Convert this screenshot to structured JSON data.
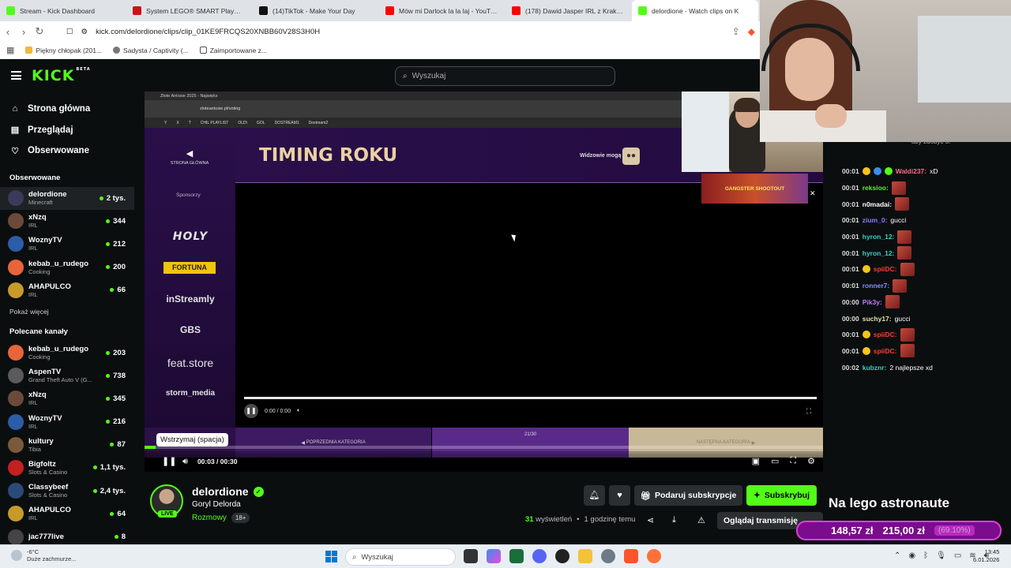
{
  "browser": {
    "tabs": [
      {
        "title": "Stream - Kick Dashboard",
        "icon": "kick"
      },
      {
        "title": "System LEGO® SMART Play™ | Witaj",
        "icon": "lego"
      },
      {
        "title": "(14)TikTok - Make Your Day",
        "icon": "tt"
      },
      {
        "title": "Mów mi Darlock la la laj - YouTube",
        "icon": "yt"
      },
      {
        "title": "(178) Dawid Jasper IRL z Krakowa - S",
        "icon": "yt"
      },
      {
        "title": "delordione - Watch clips on K",
        "icon": "kick",
        "active": true
      }
    ],
    "url": "kick.com/delordione/clips/clip_01KE9FRCQS20XNBB60V28S3H0H",
    "bookmarks": [
      "Piękny chłopak (201...",
      "Sadysta / Captivity (...",
      "Zaimportowane z..."
    ]
  },
  "header": {
    "logo": "KICK",
    "logo_badge": "BETA",
    "search_placeholder": "Wyszukaj"
  },
  "sidebar": {
    "nav": [
      "Strona główna",
      "Przeglądaj",
      "Obserwowane"
    ],
    "followed_title": "Obserwowane",
    "followed": [
      {
        "name": "delordione",
        "category": "Minecraft",
        "viewers": "2 tys.",
        "color": "#3a3a5a"
      },
      {
        "name": "xNzq",
        "category": "IRL",
        "viewers": "344",
        "color": "#6b4a3a"
      },
      {
        "name": "WoznyTV",
        "category": "IRL",
        "viewers": "212",
        "color": "#2b5da8"
      },
      {
        "name": "kebab_u_rudego",
        "category": "Cooking",
        "viewers": "200",
        "color": "#e8643a"
      },
      {
        "name": "AHAPULCO",
        "category": "IRL",
        "viewers": "66",
        "color": "#c89a2a"
      }
    ],
    "show_more": "Pokaż więcej",
    "recommended_title": "Polecane kanały",
    "recommended": [
      {
        "name": "kebab_u_rudego",
        "category": "Cooking",
        "viewers": "203",
        "color": "#e8643a"
      },
      {
        "name": "AspenTV",
        "category": "Grand Theft Auto V (G...",
        "viewers": "738",
        "color": "#5a5a5a"
      },
      {
        "name": "xNzq",
        "category": "IRL",
        "viewers": "345",
        "color": "#6b4a3a"
      },
      {
        "name": "WoznyTV",
        "category": "IRL",
        "viewers": "216",
        "color": "#2b5da8"
      },
      {
        "name": "kultury",
        "category": "Tibia",
        "viewers": "87",
        "color": "#7a5a3a"
      },
      {
        "name": "Bigfoltz",
        "category": "Slots & Casino",
        "viewers": "1,1 tys.",
        "color": "#c42020"
      },
      {
        "name": "Classybeef",
        "category": "Slots & Casino",
        "viewers": "2,4 tys.",
        "color": "#2a4a7a"
      },
      {
        "name": "AHAPULCO",
        "category": "IRL",
        "viewers": "64",
        "color": "#c89a2a"
      },
      {
        "name": "jac777live",
        "category": "",
        "viewers": "8",
        "color": "#444"
      }
    ]
  },
  "player": {
    "inner_tab": "Złote Antosie 2025 - Najwięks",
    "inner_url": "zloteantosie.pl/voting",
    "inner_bookmarks": [
      "Y",
      "X",
      "T",
      "CHIL PLAYLIST",
      "OLD\\",
      "GOL",
      "DOSTREAM1",
      "Dostream2"
    ],
    "page_back": "STRONA GŁÓWNA",
    "page_title": "TIMING ROKU",
    "viewers_can": "Widzowie mogą",
    "sponsors_heading": "Sponsorzy",
    "sponsors": [
      "HOLY",
      "FORTUNA",
      "inStreamly",
      "GBS",
      "feat.store",
      "storm_media"
    ],
    "inner_time": "0:00 / 0:00",
    "prev_category": "POPRZEDNIA KATEGORIA",
    "counter": "21/30",
    "next_category": "NASTĘPNA KATEGORIA",
    "ad_text": "GANGSTER SHOOTOUT",
    "tooltip": "Wstrzymaj (spacja)",
    "timecode": "00:03 / 00:30",
    "progress": 0.016
  },
  "clip": {
    "channel": "delordione",
    "live": "LIVE",
    "title": "Goryl Delorda",
    "category": "Rozmowy",
    "age": "18+",
    "gift_label": "Podaruj subskrypcje",
    "subscribe_label": "Subskrybuj",
    "views_count": "31",
    "views_label": "wyświetleń",
    "posted": "1 godzinę temu",
    "watch_label": "Oglądaj transmisję"
  },
  "chat": {
    "top_text": "aby zdobyć 3.",
    "messages": [
      {
        "time": "00:01",
        "user": "Waldi237",
        "text": "xD",
        "color": "#ff6b8a",
        "badges": 3
      },
      {
        "time": "00:01",
        "user": "reksioo",
        "text": "",
        "color": "#53fc18",
        "emote": true
      },
      {
        "time": "00:01",
        "user": "n0madai",
        "text": "",
        "color": "#ffffff",
        "emote": true
      },
      {
        "time": "00:01",
        "user": "zium_0",
        "text": "gucci",
        "color": "#8a7dff"
      },
      {
        "time": "00:01",
        "user": "hyron_12",
        "text": "",
        "color": "#3ad0c0",
        "emote": true
      },
      {
        "time": "00:01",
        "user": "hyron_12",
        "text": "",
        "color": "#3ad0c0",
        "emote": true
      },
      {
        "time": "00:01",
        "user": "spiiDC",
        "text": "",
        "color": "#ff3a3a",
        "emote": true,
        "badges": 1
      },
      {
        "time": "00:01",
        "user": "ronner7",
        "text": "",
        "color": "#8a8dff",
        "emote": true
      },
      {
        "time": "00:00",
        "user": "Pik3y",
        "text": "",
        "color": "#c07aff",
        "emote": true
      },
      {
        "time": "00:00",
        "user": "suchy17",
        "text": "gucci",
        "color": "#e0e0a0"
      },
      {
        "time": "00:01",
        "user": "spiiDC",
        "text": "",
        "color": "#ff3a3a",
        "emote": true,
        "badges": 1
      },
      {
        "time": "00:01",
        "user": "spiiDC",
        "text": "",
        "color": "#ff3a3a",
        "emote": true,
        "badges": 1
      },
      {
        "time": "00:02",
        "user": "kubznr",
        "text": "2 najlepsze xd",
        "color": "#3ad0c0"
      }
    ]
  },
  "overlay": {
    "donation_text": "Na lego astronaute",
    "current": "148,57 zł",
    "goal": "215,00 zł",
    "percent": "(69.10%)"
  },
  "taskbar": {
    "temp": "-6°C",
    "weather": "Duże zachmurze...",
    "search": "Wyszukaj",
    "time": "13:45",
    "date": "6.01.2026"
  }
}
